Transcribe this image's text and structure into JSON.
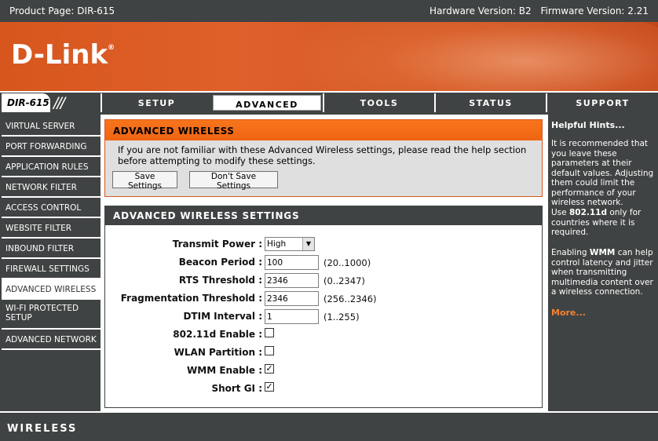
{
  "topbar": {
    "product_page": "Product Page: DIR-615",
    "hardware_version": "Hardware Version: B2",
    "firmware_version": "Firmware Version: 2.21"
  },
  "banner": {
    "logo": "D-Link",
    "logo_mark": "®"
  },
  "nav": {
    "model": "DIR-615",
    "tabs": [
      {
        "label": "SETUP"
      },
      {
        "label": "ADVANCED"
      },
      {
        "label": "TOOLS"
      },
      {
        "label": "STATUS"
      },
      {
        "label": "SUPPORT"
      }
    ],
    "active_tab": "ADVANCED"
  },
  "sidebar": {
    "items": [
      {
        "label": "VIRTUAL SERVER"
      },
      {
        "label": "PORT FORWARDING"
      },
      {
        "label": "APPLICATION RULES"
      },
      {
        "label": "NETWORK FILTER"
      },
      {
        "label": "ACCESS CONTROL"
      },
      {
        "label": "WEBSITE FILTER"
      },
      {
        "label": "INBOUND FILTER"
      },
      {
        "label": "FIREWALL SETTINGS"
      },
      {
        "label": "ADVANCED WIRELESS"
      },
      {
        "label": "WI-FI PROTECTED SETUP"
      },
      {
        "label": "ADVANCED NETWORK"
      }
    ],
    "active_item": "ADVANCED WIRELESS"
  },
  "intro": {
    "title": "ADVANCED WIRELESS",
    "description": "If you are not familiar with these Advanced Wireless settings, please read the help section before attempting to modify these settings.",
    "save_label": "Save Settings",
    "dont_save_label": "Don't Save Settings"
  },
  "settings": {
    "title": "ADVANCED WIRELESS SETTINGS",
    "transmit_power": {
      "label": "Transmit Power :",
      "value": "High"
    },
    "beacon_period": {
      "label": "Beacon Period :",
      "value": "100",
      "range": "(20..1000)"
    },
    "rts_threshold": {
      "label": "RTS Threshold :",
      "value": "2346",
      "range": "(0..2347)"
    },
    "fragmentation_threshold": {
      "label": "Fragmentation Threshold :",
      "value": "2346",
      "range": "(256..2346)"
    },
    "dtim_interval": {
      "label": "DTIM Interval :",
      "value": "1",
      "range": "(1..255)"
    },
    "dot11d_enable": {
      "label": "802.11d Enable :",
      "checked": false
    },
    "wlan_partition": {
      "label": "WLAN Partition :",
      "checked": false
    },
    "wmm_enable": {
      "label": "WMM Enable :",
      "checked": true
    },
    "short_gi": {
      "label": "Short GI :",
      "checked": true
    },
    "check_mark": "✓"
  },
  "hints": {
    "title": "Helpful Hints...",
    "hint1": "It is recommended that you leave these parameters at their default values. Adjusting them could limit the performance of your wireless network.",
    "hint2_pre": "Use ",
    "hint2_bold": "802.11d",
    "hint2_post": " only for countries where it is required.",
    "hint3_pre": "Enabling ",
    "hint3_bold": "WMM",
    "hint3_post": " can help control latency and jitter when transmitting multimedia content over a wireless connection.",
    "more": "More..."
  },
  "footer": {
    "label": "WIRELESS"
  },
  "colors": {
    "dark": "#404343",
    "orange": "#f66f15",
    "link": "#f28232"
  }
}
